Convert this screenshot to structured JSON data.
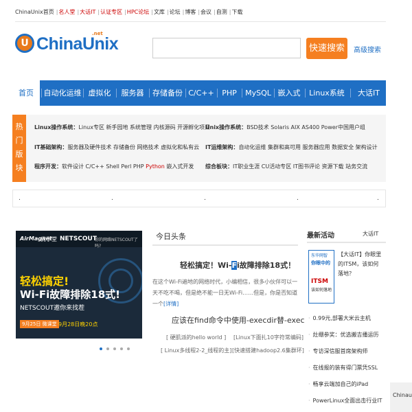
{
  "toplinks": [
    {
      "label": "ChinaUnix首页",
      "red": false
    },
    {
      "label": "名人堂",
      "red": true
    },
    {
      "label": "大话IT",
      "red": true
    },
    {
      "label": "认证专区",
      "red": true
    },
    {
      "label": "HPC论坛",
      "red": true
    },
    {
      "label": "文库",
      "red": false
    },
    {
      "label": "论坛",
      "red": false
    },
    {
      "label": "博客",
      "red": false
    },
    {
      "label": "会议",
      "red": false
    },
    {
      "label": "自测",
      "red": false
    },
    {
      "label": "下载",
      "red": false
    }
  ],
  "logo": {
    "text": "ChinaUnix",
    "net": ".net",
    "mark": "U"
  },
  "search": {
    "value": "",
    "button": "快速搜索",
    "advanced": "高级搜索"
  },
  "nav": [
    "首页",
    "自动化运维",
    "虚拟化",
    "服务器",
    "存储备份",
    "C/C++",
    "PHP",
    "MySQL",
    "嵌入式",
    "Linux系统",
    "大话IT"
  ],
  "hot": {
    "tag": "热门版块",
    "left": [
      {
        "title": "Linux操作系统：",
        "items": "Linux专区  新手园地  系统管理  内核源码  开源孵化项目"
      },
      {
        "title": "IT基础架构：",
        "items": "服务器及硬件技术  存储备份  网络技术  虚拟化和私有云"
      },
      {
        "title": "程序开发：",
        "items": "软件设计  C/C++  Shell  Perl  PHP  ",
        "red": "Python",
        "after": "  嵌入式开发"
      }
    ],
    "right": [
      {
        "title": "Unix操作系统：",
        "items": "BSD技术  Solaris  AIX  AS400  Power中国用户组"
      },
      {
        "title": "IT运维架构：",
        "items": "自动化运维  集群和高可用  服务器应用  数据安全  架构设计"
      },
      {
        "title": "综合板块：",
        "items": "IT职业生涯  CU活动专区  IT图书评论  资源下载  站务交流"
      }
    ]
  },
  "dots": [
    ".",
    ".",
    ".",
    ".",
    "."
  ],
  "slider": {
    "brand1": "AirMagnet",
    "brand2": "优学堂",
    "brand3": "NETSCOUT",
    "brand4": "你的网络NETSCOUT了吗?",
    "headline1": "轻松搞定!",
    "headline2": "Wi-Fi故障排除18式!",
    "sub": "NETSCOUT邀你来找茬",
    "date_tag": "9月25日 微课堂",
    "date": "9月28日晚20点",
    "pages": 5,
    "active_page": 0
  },
  "headlines": {
    "title": "今日头条",
    "main_before": "轻松搞定！Wi-",
    "main_hi": "F",
    "main_after": "i故障排除18式！",
    "summary": "在这个Wi-Fi遍地的网络时代，小编相信，很多小伙伴可以一天不吃不喝，但是绝不能一日无Wi-Fi……但是，你是否知道一个",
    "more": "[详情]",
    "main2": "应该在find命令中使用-execdir替-exec",
    "sub": [
      "[ 硬肌派的hello world ]",
      "[Linux下面扎10字符常编码]",
      "[ Linux多线程2-2_线程的主]",
      "[快速搭建hadoop2.6集群环]"
    ]
  },
  "activity": {
    "title": "最新活动",
    "more": "大话IT",
    "img": {
      "a1": "东华网智",
      "a2": "你眼中的",
      "a3": "ITSM",
      "a4": "该如何落地"
    },
    "desc": "【大话IT】你眼里的ITSM，该如何落地？",
    "list": [
      "0.99元,部署大米云主机",
      "灶绷参奖：优选搬吉播运历",
      "专访深信服首席架构师",
      "在线报的装有得门票凭SSL",
      "畅享云端加自己的iPad",
      "PowerLinux全面出击行业IT"
    ]
  },
  "side_tab": "Chinaunix"
}
